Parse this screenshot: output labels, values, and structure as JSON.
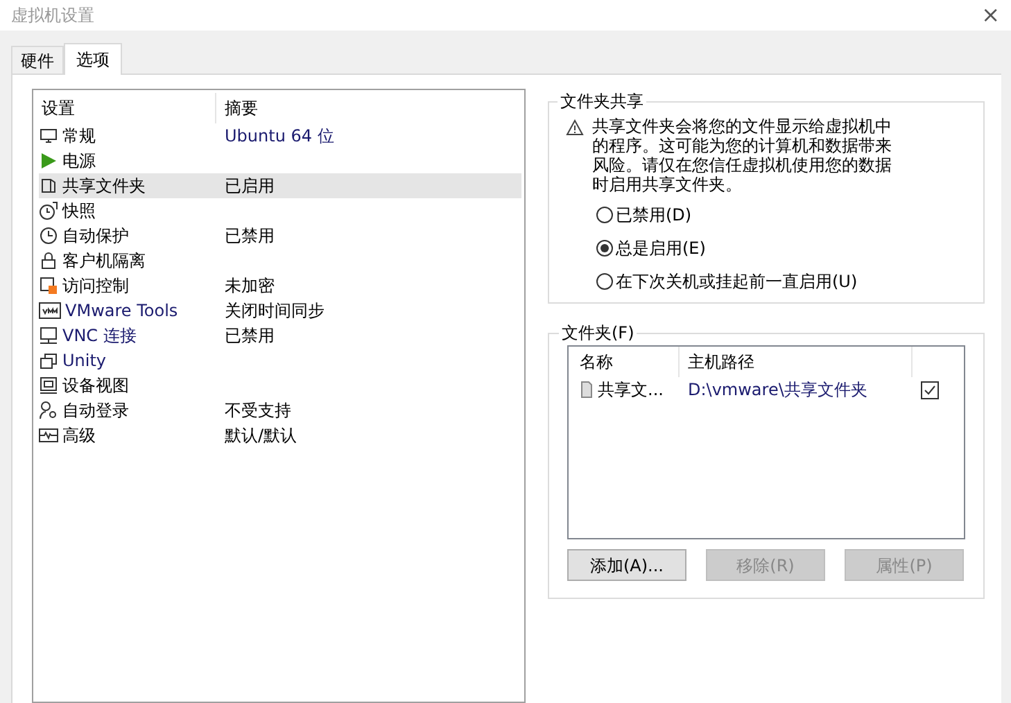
{
  "window": {
    "title": "虚拟机设置",
    "close": "×"
  },
  "tabs": [
    {
      "label": "硬件",
      "selected": false
    },
    {
      "label": "选项",
      "selected": true
    }
  ],
  "settings": {
    "columns": [
      "设置",
      "摘要"
    ],
    "rows": [
      {
        "name": "常规",
        "summary": "Ubuntu 64 位",
        "selected": false
      },
      {
        "name": "电源",
        "summary": "",
        "selected": false
      },
      {
        "name": "共享文件夹",
        "summary": "已启用",
        "selected": true
      },
      {
        "name": "快照",
        "summary": "",
        "selected": false
      },
      {
        "name": "自动保护",
        "summary": "已禁用",
        "selected": false
      },
      {
        "name": "客户机隔离",
        "summary": "",
        "selected": false
      },
      {
        "name": "访问控制",
        "summary": "未加密",
        "selected": false
      },
      {
        "name": "VMware Tools",
        "summary": "关闭时间同步",
        "selected": false
      },
      {
        "name": "VNC 连接",
        "summary": "已禁用",
        "selected": false
      },
      {
        "name": "Unity",
        "summary": "",
        "selected": false
      },
      {
        "name": "设备视图",
        "summary": "",
        "selected": false
      },
      {
        "name": "自动登录",
        "summary": "不受支持",
        "selected": false
      },
      {
        "name": "高级",
        "summary": "默认/默认",
        "selected": false
      }
    ]
  },
  "folder_sharing": {
    "title": "文件夹共享",
    "warning": "共享文件夹会将您的文件显示给虚拟机中的程序。这可能为您的计算机和数据带来风险。请仅在您信任虚拟机使用您的数据时启用共享文件夹。",
    "options": [
      {
        "label": "已禁用(D)",
        "selected": false
      },
      {
        "label": "总是启用(E)",
        "selected": true
      },
      {
        "label": "在下次关机或挂起前一直启用(U)",
        "selected": false
      }
    ]
  },
  "folders": {
    "title": "文件夹(F)",
    "columns": [
      "名称",
      "主机路径"
    ],
    "rows": [
      {
        "name": "共享文...",
        "path": "D:\\vmware\\共享文件夹",
        "checked": true
      }
    ],
    "buttons": [
      {
        "label": "添加(A)...",
        "disabled": false
      },
      {
        "label": "移除(R)",
        "disabled": true
      },
      {
        "label": "属性(P)",
        "disabled": true
      }
    ]
  }
}
